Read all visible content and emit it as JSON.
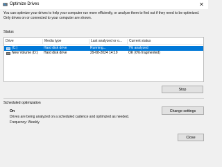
{
  "window": {
    "title": "Optimize Drives",
    "close_glyph": "✕"
  },
  "description": "You can optimize your drives to help your computer run more efficiently, or analyze them to find out if they need to be optimized. Only drives on or connected to your computer are shown.",
  "status": {
    "label": "Status",
    "columns": [
      "Drive",
      "Media type",
      "Last analyzed or o...",
      "Current status"
    ],
    "rows": [
      {
        "drive": "(C:)",
        "media_type": "Hard disk drive",
        "last_analyzed": "Running...",
        "current_status": "7% analyzed",
        "icon": "os-drive-icon",
        "selected": true
      },
      {
        "drive": "New Volume (D:)",
        "media_type": "Hard disk drive",
        "last_analyzed": "29-08-2024 14:19",
        "current_status": "OK (0% fragmented)",
        "icon": "drive-icon",
        "selected": false
      }
    ],
    "stop_label": "Stop"
  },
  "scheduled": {
    "label": "Scheduled optimization",
    "state": "On",
    "description": "Drives are being analyzed on a scheduled cadence and optimized as needed.",
    "frequency": "Frequency: Weekly",
    "change_label": "Change settings"
  },
  "footer": {
    "close_label": "Close"
  },
  "colors": {
    "selection": "#0078d7",
    "window_bg": "#f0f0f0",
    "button_bg": "#e1e1e1"
  }
}
